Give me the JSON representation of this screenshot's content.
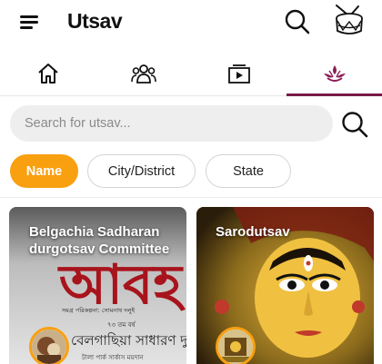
{
  "app": {
    "title": "Utsav"
  },
  "tabs": [
    {
      "icon": "home-icon"
    },
    {
      "icon": "group-icon"
    },
    {
      "icon": "video-icon"
    },
    {
      "icon": "diya-icon",
      "active": true
    }
  ],
  "search": {
    "placeholder": "Search for utsav..."
  },
  "filters": [
    {
      "label": "Name",
      "selected": true
    },
    {
      "label": "City/District",
      "selected": false
    },
    {
      "label": "State",
      "selected": false
    }
  ],
  "cards": [
    {
      "title": "Belgachia Sadharan durgotsav Committee",
      "poster_lines": [
        "আবহ",
        "সমগ্র পরিকল্পনা: সোমনাথ দলুই",
        "৭৩ তম বর্ষ",
        "বেলগাছিয়া সাধারণ দুর্গো",
        "টালা পার্ক সার্কাস ময়দান"
      ]
    },
    {
      "title": "Sarodutsav"
    }
  ],
  "colors": {
    "accent": "#f9a010",
    "tab_indicator": "#7a1a4a",
    "diya": "#8b1d55"
  }
}
